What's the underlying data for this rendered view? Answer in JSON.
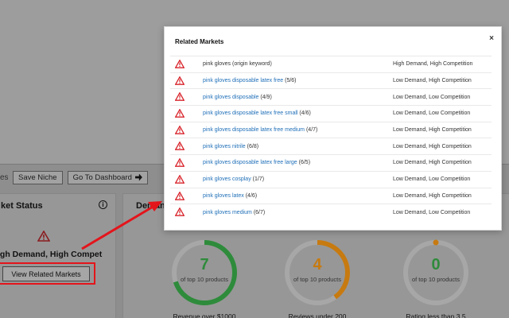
{
  "toolbar": {
    "clip_text": "es",
    "save_label": "Save Niche",
    "dashboard_label": "Go To Dashboard"
  },
  "market_status": {
    "title": "ket Status",
    "status_text": "igh Demand, High Competition",
    "view_button_label": "View Related Markets"
  },
  "demand_card": {
    "title": "Demand"
  },
  "gauges": [
    {
      "value": "7",
      "subtitle": "of top 10 products",
      "caption": "Revenue over $1000",
      "color": "#2e8b3b",
      "fraction": 0.7
    },
    {
      "value": "4",
      "subtitle": "of top 10 products",
      "caption": "Reviews under 200",
      "color": "#c77a10",
      "fraction": 0.4
    },
    {
      "value": "0",
      "subtitle": "of top 10 products",
      "caption": "Rating less than 3.5",
      "color": "#2e8b3b",
      "fraction": 0.0
    }
  ],
  "modal": {
    "title": "Related Markets",
    "close_label": "×",
    "rows": [
      {
        "keyword": "pink gloves",
        "suffix": "(origin keyword)",
        "status": "High Demand, High Competition",
        "link": false
      },
      {
        "keyword": "pink gloves disposable latex free",
        "suffix": "(5/6)",
        "status": "Low Demand, High Competition",
        "link": true
      },
      {
        "keyword": "pink gloves disposable",
        "suffix": "(4/9)",
        "status": "Low Demand, Low Competition",
        "link": true
      },
      {
        "keyword": "pink gloves disposable latex free small",
        "suffix": "(4/6)",
        "status": "Low Demand, Low Competition",
        "link": true
      },
      {
        "keyword": "pink gloves disposable latex free medium",
        "suffix": "(4/7)",
        "status": "Low Demand, High Competition",
        "link": true
      },
      {
        "keyword": "pink gloves nitrile",
        "suffix": "(6/8)",
        "status": "Low Demand, High Competition",
        "link": true
      },
      {
        "keyword": "pink gloves disposable latex free large",
        "suffix": "(6/5)",
        "status": "Low Demand, High Competition",
        "link": true
      },
      {
        "keyword": "pink gloves cosplay",
        "suffix": "(1/7)",
        "status": "Low Demand, Low Competition",
        "link": true
      },
      {
        "keyword": "pink gloves latex",
        "suffix": "(4/6)",
        "status": "Low Demand, High Competition",
        "link": true
      },
      {
        "keyword": "pink gloves medium",
        "suffix": "(6/7)",
        "status": "Low Demand, Low Competition",
        "link": true
      }
    ]
  },
  "colors": {
    "link": "#1f6fb8",
    "warning": "#d8232a",
    "highlight": "#e4141b"
  }
}
